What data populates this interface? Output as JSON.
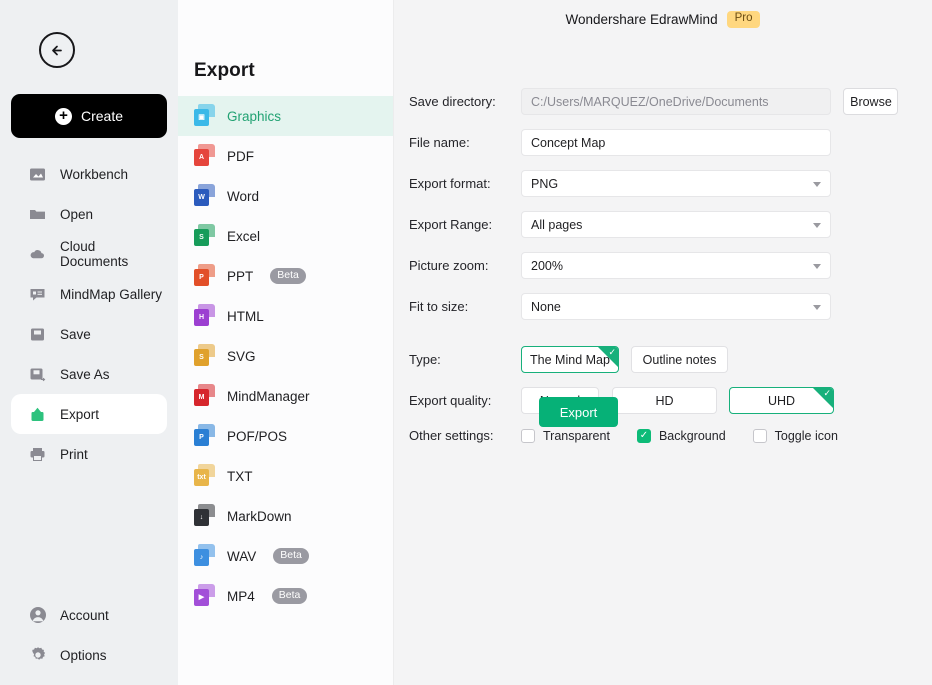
{
  "header": {
    "app_title": "Wondershare EdrawMind",
    "pro_badge": "Pro"
  },
  "sidebar": {
    "back_label": "Back",
    "create_label": "Create",
    "items": [
      {
        "label": "Workbench",
        "icon": "workbench-icon"
      },
      {
        "label": "Open",
        "icon": "folder-icon"
      },
      {
        "label": "Cloud Documents",
        "icon": "cloud-icon"
      },
      {
        "label": "MindMap Gallery",
        "icon": "gallery-icon"
      },
      {
        "label": "Save",
        "icon": "save-icon"
      },
      {
        "label": "Save As",
        "icon": "save-as-icon"
      },
      {
        "label": "Export",
        "icon": "export-icon"
      },
      {
        "label": "Print",
        "icon": "printer-icon"
      }
    ],
    "bottom_items": [
      {
        "label": "Account",
        "icon": "account-icon"
      },
      {
        "label": "Options",
        "icon": "gear-icon"
      }
    ]
  },
  "formats_panel": {
    "title": "Export",
    "items": [
      {
        "label": "Graphics",
        "badge": "",
        "color": "#3bb9e8",
        "glyph": "▣",
        "active": true
      },
      {
        "label": "PDF",
        "badge": "",
        "color": "#e5453c",
        "glyph": "A"
      },
      {
        "label": "Word",
        "badge": "",
        "color": "#2b5bbd",
        "glyph": "W"
      },
      {
        "label": "Excel",
        "badge": "",
        "color": "#179c5a",
        "glyph": "S"
      },
      {
        "label": "PPT",
        "badge": "Beta",
        "color": "#e24f28",
        "glyph": "P"
      },
      {
        "label": "HTML",
        "badge": "",
        "color": "#9c3fd1",
        "glyph": "H"
      },
      {
        "label": "SVG",
        "badge": "",
        "color": "#e0a12c",
        "glyph": "S"
      },
      {
        "label": "MindManager",
        "badge": "",
        "color": "#d6262c",
        "glyph": "M"
      },
      {
        "label": "POF/POS",
        "badge": "",
        "color": "#2a7fd4",
        "glyph": "P"
      },
      {
        "label": "TXT",
        "badge": "",
        "color": "#e8b54a",
        "glyph": "txt"
      },
      {
        "label": "MarkDown",
        "badge": "",
        "color": "#2f3136",
        "glyph": "↓"
      },
      {
        "label": "WAV",
        "badge": "Beta",
        "color": "#3d8fe0",
        "glyph": "♪"
      },
      {
        "label": "MP4",
        "badge": "Beta",
        "color": "#a24fd8",
        "glyph": "▶"
      }
    ]
  },
  "form": {
    "save_directory": {
      "label": "Save directory:",
      "value": "C:/Users/MARQUEZ/OneDrive/Documents",
      "browse_label": "Browse"
    },
    "file_name": {
      "label": "File name:",
      "value": "Concept Map"
    },
    "export_format": {
      "label": "Export format:",
      "value": "PNG"
    },
    "export_range": {
      "label": "Export Range:",
      "value": "All pages"
    },
    "picture_zoom": {
      "label": "Picture zoom:",
      "value": "200%"
    },
    "fit_to_size": {
      "label": "Fit to size:",
      "value": "None"
    },
    "type": {
      "label": "Type:",
      "options": [
        {
          "label": "The Mind Map",
          "selected": true
        },
        {
          "label": "Outline notes",
          "selected": false
        }
      ]
    },
    "export_quality": {
      "label": "Export quality:",
      "options": [
        {
          "label": "Normal",
          "selected": false
        },
        {
          "label": "HD",
          "selected": false
        },
        {
          "label": "UHD",
          "selected": true
        }
      ]
    },
    "other_settings": {
      "label": "Other settings:",
      "options": [
        {
          "label": "Transparent",
          "checked": false
        },
        {
          "label": "Background",
          "checked": true
        },
        {
          "label": "Toggle icon",
          "checked": false
        }
      ]
    },
    "export_button": "Export"
  },
  "colors": {
    "accent_green": "#06b177",
    "select_green": "#17b07b",
    "pro_yellow": "#ffd77f",
    "row_active": "#e4f4ef"
  }
}
